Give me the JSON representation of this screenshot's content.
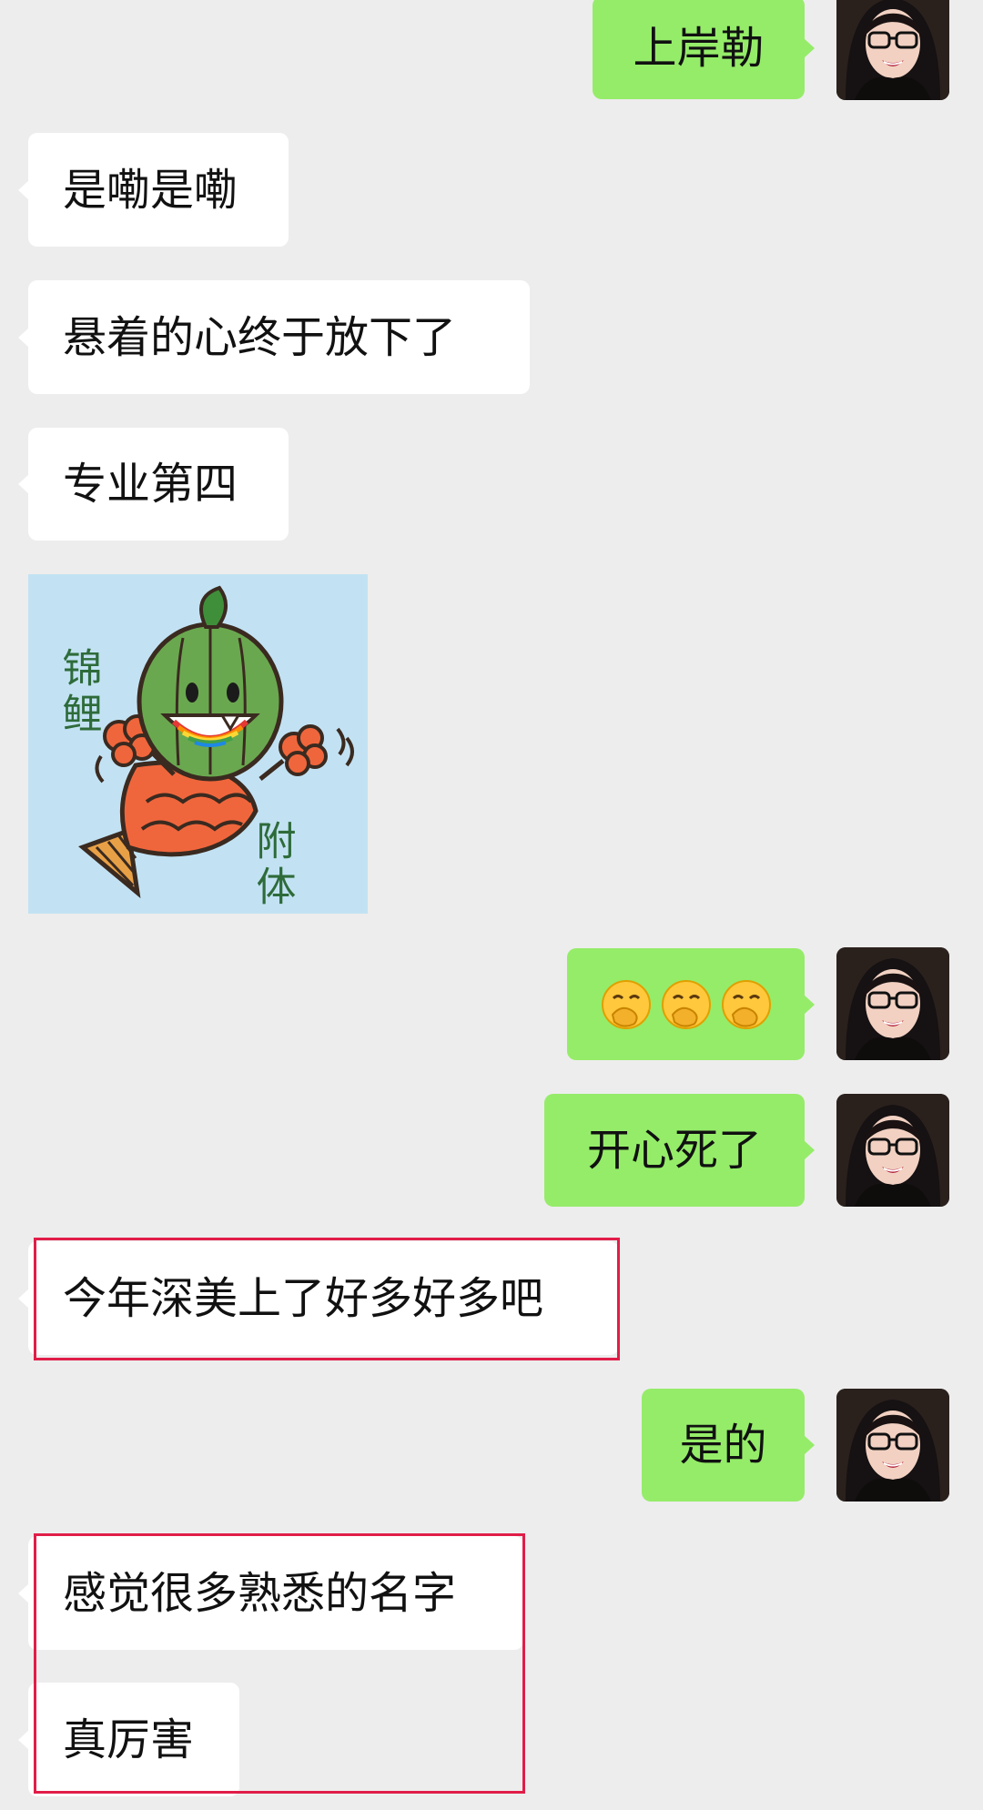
{
  "messages": {
    "out_1": "上岸勒",
    "in_1": "是嘞是嘞",
    "in_2": "悬着的心终于放下了",
    "in_3": "专业第四",
    "sticker": {
      "text_top": "锦鲤",
      "text_bottom": "附体"
    },
    "out_2_emoji": "smiling-face-with-hand-over-mouth",
    "out_3": "开心死了",
    "in_4": "今年深美上了好多好多吧",
    "out_4": "是的",
    "in_5": "感觉很多熟悉的名字",
    "in_6": "真厉害"
  },
  "colors": {
    "background": "#ededed",
    "incoming_bubble": "#ffffff",
    "outgoing_bubble": "#95ec69",
    "highlight_box": "#e11d48"
  }
}
